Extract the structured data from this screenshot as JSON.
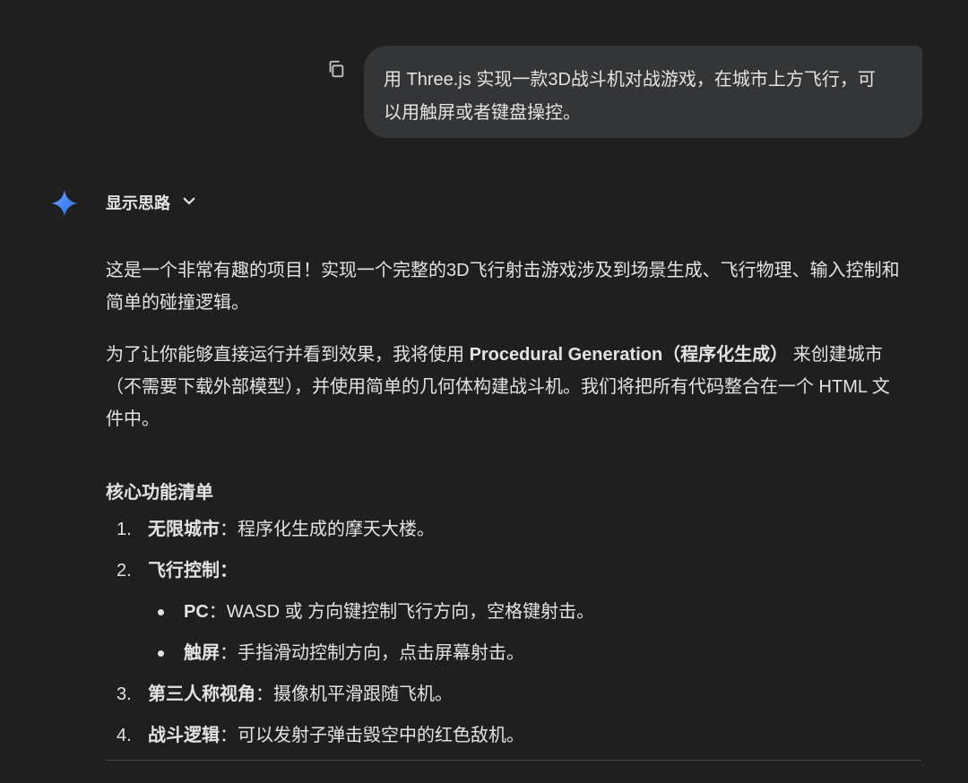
{
  "user_prompt": {
    "line1": "用 Three.js 实现一款3D战斗机对战游戏，在城市上方飞行，可",
    "line2": "以用触屏或者键盘操控。",
    "copy_icon": "copy-icon"
  },
  "response": {
    "spark_icon": "gemini-spark-icon",
    "show_thinking_label": "显示思路",
    "para1_line1": "这是一个非常有趣的项目！实现一个完整的3D飞行射击游戏涉及到场景生成、飞行物理、输入控制和",
    "para1_line2": "简单的碰撞逻辑。",
    "para2_line1_a": "为了让你能够直接运行并看到效果，我将使用 ",
    "para2_line1_bold": "Procedural Generation（程序化生成）",
    "para2_line1_b": " 来创建城市",
    "para2_line2": "（不需要下载外部模型），并使用简单的几何体构建战斗机。我们将把所有代码整合在一个 HTML 文",
    "para2_line3": "件中。",
    "section_title": "核心功能清单",
    "items": [
      {
        "num": "1.",
        "bold": "无限城市",
        "text": "：程序化生成的摩天大楼。"
      },
      {
        "num": "2.",
        "bold": "飞行控制",
        "text": "："
      },
      {
        "num": "3.",
        "bold": "第三人称视角",
        "text": "：摄像机平滑跟随飞机。"
      },
      {
        "num": "4.",
        "bold": "战斗逻辑",
        "text": "：可以发射子弹击毁空中的红色敌机。"
      }
    ],
    "sub_items": [
      {
        "bold": "PC",
        "text": "：WASD 或 方向键控制飞行方向，空格键射击。"
      },
      {
        "bold": "触屏",
        "text": "：手指滑动控制方向，点击屏幕射击。"
      }
    ]
  },
  "colors": {
    "background": "#1f1f1f",
    "bubble": "#333537",
    "text": "#e3e3e3",
    "spark_blue": "#4285f4"
  }
}
